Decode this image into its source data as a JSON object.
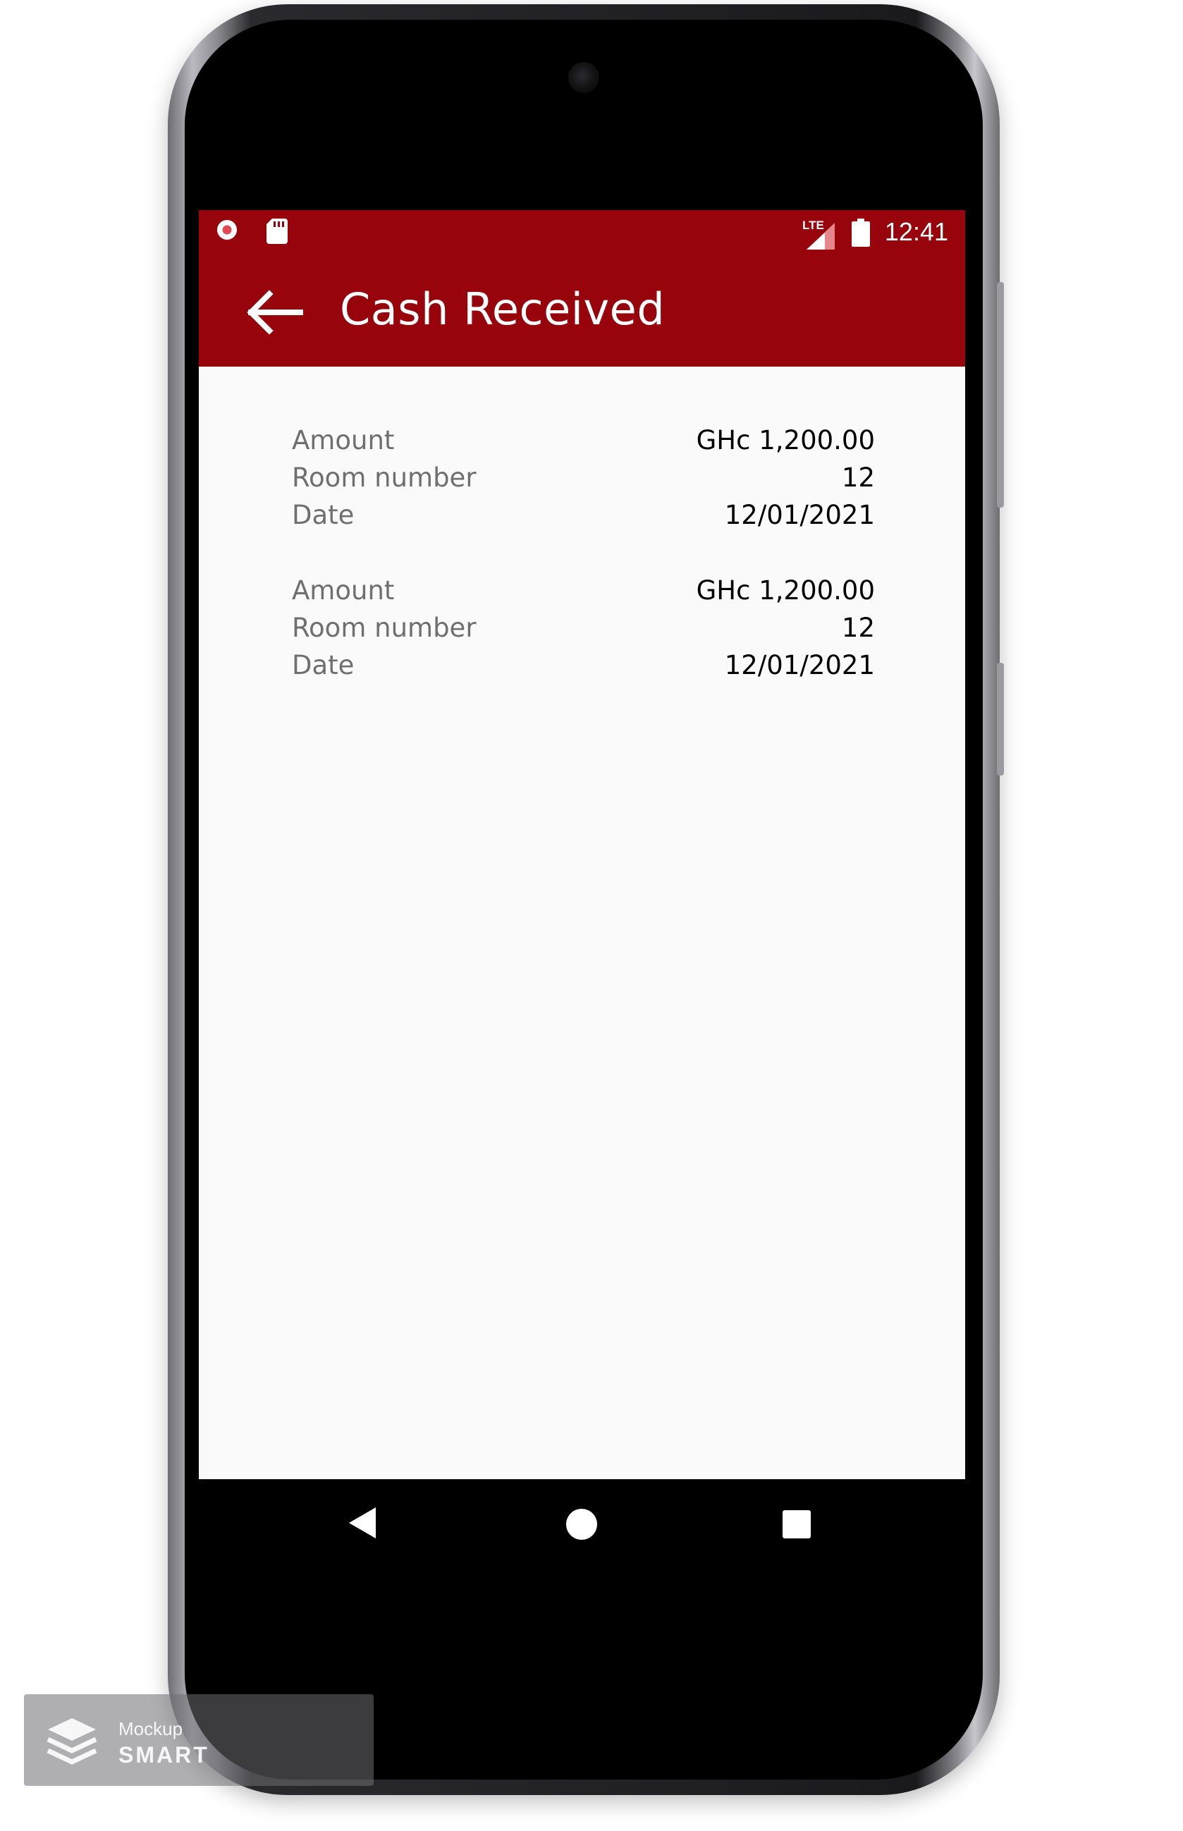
{
  "status_bar": {
    "network_label": "LTE",
    "time": "12:41"
  },
  "app_bar": {
    "title": "Cash Received",
    "background_color": "#97040c"
  },
  "records": [
    {
      "amount_label": "Amount",
      "amount": "GHc 1,200.00",
      "room_label": "Room number",
      "room": "12",
      "date_label": "Date",
      "date": "12/01/2021"
    },
    {
      "amount_label": "Amount",
      "amount": "GHc 1,200.00",
      "room_label": "Room number",
      "room": "12",
      "date_label": "Date",
      "date": "12/01/2021"
    }
  ],
  "nav_bar": {
    "icons": [
      "back-triangle-icon",
      "home-circle-icon",
      "recents-square-icon"
    ]
  },
  "watermark": {
    "small_text": "Mockup",
    "brand_text": "SMART"
  }
}
